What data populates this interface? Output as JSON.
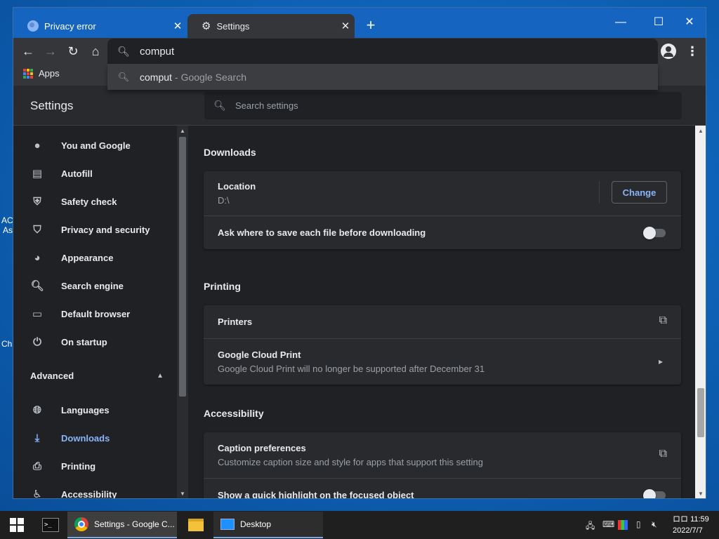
{
  "desktop": {
    "icon_fragments": [
      "AC",
      "As",
      "Ch"
    ]
  },
  "browser": {
    "tabs": [
      {
        "title": "Privacy error",
        "active": false
      },
      {
        "title": "Settings",
        "active": true
      }
    ],
    "new_tab_label": "+",
    "window_controls": {
      "minimize": "—",
      "maximize": "☐",
      "close": "✕"
    },
    "omnibox": {
      "value": "comput"
    },
    "suggestion": {
      "query": "comput",
      "separator": "-",
      "source": "Google Search"
    },
    "bookmarks": {
      "apps_label": "Apps"
    }
  },
  "settings": {
    "title": "Settings",
    "search_placeholder": "Search settings",
    "sidebar": {
      "items": [
        {
          "label": "You and Google",
          "icon": "person-icon"
        },
        {
          "label": "Autofill",
          "icon": "clipboard-icon"
        },
        {
          "label": "Safety check",
          "icon": "shield-check-icon"
        },
        {
          "label": "Privacy and security",
          "icon": "shield-icon"
        },
        {
          "label": "Appearance",
          "icon": "palette-icon"
        },
        {
          "label": "Search engine",
          "icon": "search-icon"
        },
        {
          "label": "Default browser",
          "icon": "browser-icon"
        },
        {
          "label": "On startup",
          "icon": "power-icon"
        }
      ],
      "advanced_label": "Advanced",
      "advanced_items": [
        {
          "label": "Languages",
          "icon": "globe-icon",
          "active": false
        },
        {
          "label": "Downloads",
          "icon": "download-icon",
          "active": true
        },
        {
          "label": "Printing",
          "icon": "printer-icon",
          "active": false
        },
        {
          "label": "Accessibility",
          "icon": "accessibility-icon",
          "active": false
        }
      ]
    },
    "downloads": {
      "title": "Downloads",
      "location_label": "Location",
      "location_value": "D:\\",
      "change_label": "Change",
      "ask_label": "Ask where to save each file before downloading",
      "ask_enabled": false
    },
    "printing": {
      "title": "Printing",
      "printers_label": "Printers",
      "cloud_print_label": "Google Cloud Print",
      "cloud_print_sub": "Google Cloud Print will no longer be supported after December 31"
    },
    "accessibility": {
      "title": "Accessibility",
      "caption_label": "Caption preferences",
      "caption_sub": "Customize caption size and style for apps that support this setting",
      "highlight_label": "Show a quick highlight on the focused object",
      "highlight_enabled": false
    }
  },
  "taskbar": {
    "chrome_label": "Settings - Google C...",
    "desktop_label": "Desktop",
    "clock_time": "11:59",
    "clock_date": "2022/7/7",
    "ime_indicator": "ロロ"
  }
}
